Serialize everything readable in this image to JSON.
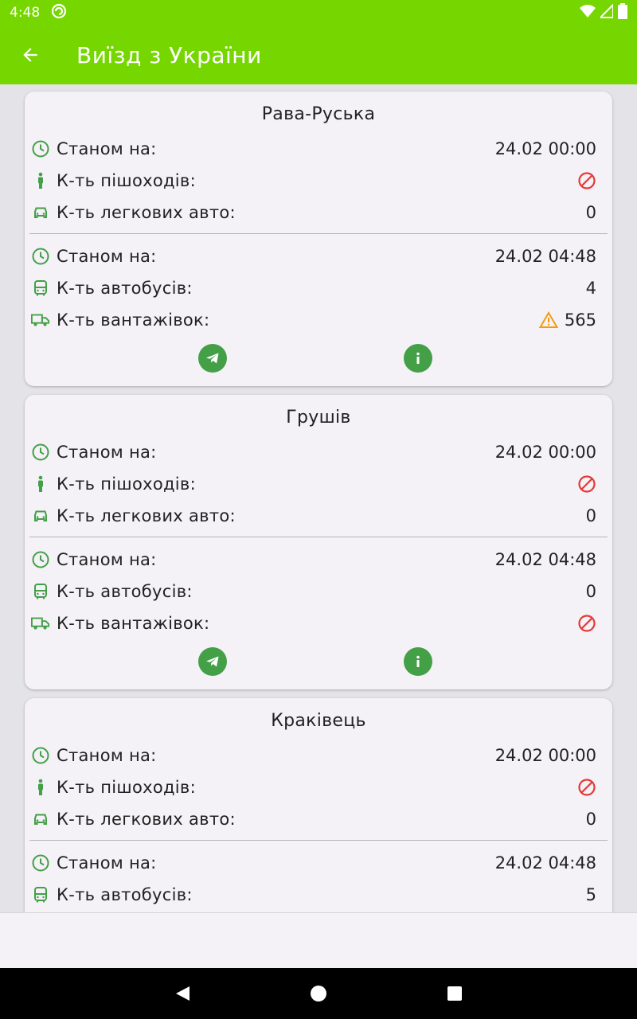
{
  "status_bar": {
    "time": "4:48"
  },
  "app_bar": {
    "title": "Виїзд з України"
  },
  "labels": {
    "as_of": "Станом на:",
    "pedestrians": "К-ть пішоходів:",
    "cars": "К-ть легкових авто:",
    "buses": "К-ть автобусів:",
    "trucks": "К-ть вантажівок:"
  },
  "colors": {
    "accent": "#76d700",
    "icon_green": "#43a047",
    "forbidden": "#e53935",
    "warning": "#f39c12"
  },
  "cards": [
    {
      "title": "Рава-Руська",
      "time1": "24.02 00:00",
      "pedestrians": "",
      "pedestrians_icon": "forbidden-icon",
      "cars": "0",
      "time2": "24.02 04:48",
      "buses": "4",
      "trucks": "565",
      "trucks_icon": "warning-icon"
    },
    {
      "title": "Грушів",
      "time1": "24.02 00:00",
      "pedestrians": "",
      "pedestrians_icon": "forbidden-icon",
      "cars": "0",
      "time2": "24.02 04:48",
      "buses": "0",
      "trucks": "",
      "trucks_icon": "forbidden-icon"
    },
    {
      "title": "Краківець",
      "time1": "24.02 00:00",
      "pedestrians": "",
      "pedestrians_icon": "forbidden-icon",
      "cars": "0",
      "time2": "24.02 04:48",
      "buses": "5"
    }
  ]
}
